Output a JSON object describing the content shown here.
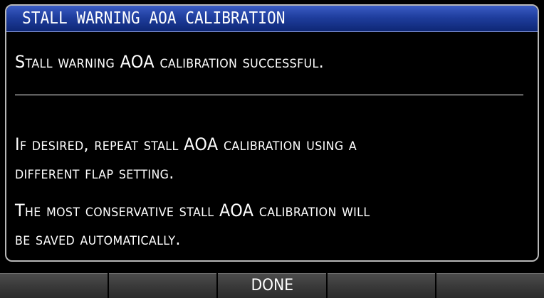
{
  "dialog": {
    "title": "STALL WARNING AOA CALIBRATION",
    "messages": {
      "success": "Stall warning AOA calibration successful.",
      "repeat_line1": "If desired, repeat stall AOA calibration using a",
      "repeat_line2": "different flap setting.",
      "saved_line1": "The most conservative stall AOA calibration will",
      "saved_line2": "be saved automatically."
    }
  },
  "softkeys": {
    "key1": "",
    "key2": "",
    "key3": "DONE",
    "key4": "",
    "key5": ""
  },
  "colors": {
    "title_bar": "#1f3e9e",
    "background": "#000000",
    "text": "#ffffff",
    "softkey": "#3a3a3a"
  }
}
